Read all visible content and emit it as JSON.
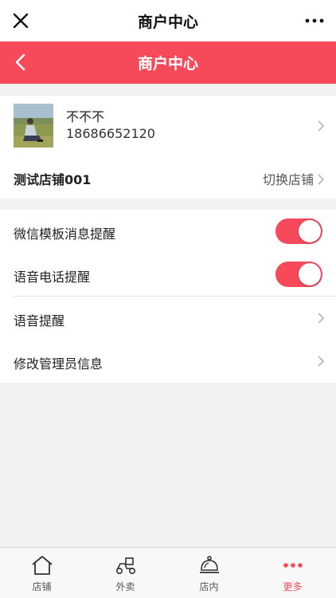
{
  "window": {
    "title": "商户中心"
  },
  "header": {
    "title": "商户中心"
  },
  "profile": {
    "name": "不不不",
    "phone": "18686652120",
    "store_name": "测试店铺001",
    "switch_store_label": "切换店铺"
  },
  "settings": {
    "items": [
      {
        "label": "微信模板消息提醒",
        "toggle_on": true
      },
      {
        "label": "语音电话提醒",
        "toggle_on": true
      },
      {
        "label": "语音提醒"
      },
      {
        "label": "修改管理员信息"
      }
    ]
  },
  "tabbar": {
    "tabs": [
      {
        "label": "店铺",
        "icon": "home-icon"
      },
      {
        "label": "外卖",
        "icon": "delivery-scooter-icon"
      },
      {
        "label": "店内",
        "icon": "service-bell-icon"
      },
      {
        "label": "更多",
        "icon": "more-dots-icon",
        "active": true
      }
    ]
  },
  "colors": {
    "accent": "#f64a5b",
    "background": "#f2f2f2"
  }
}
